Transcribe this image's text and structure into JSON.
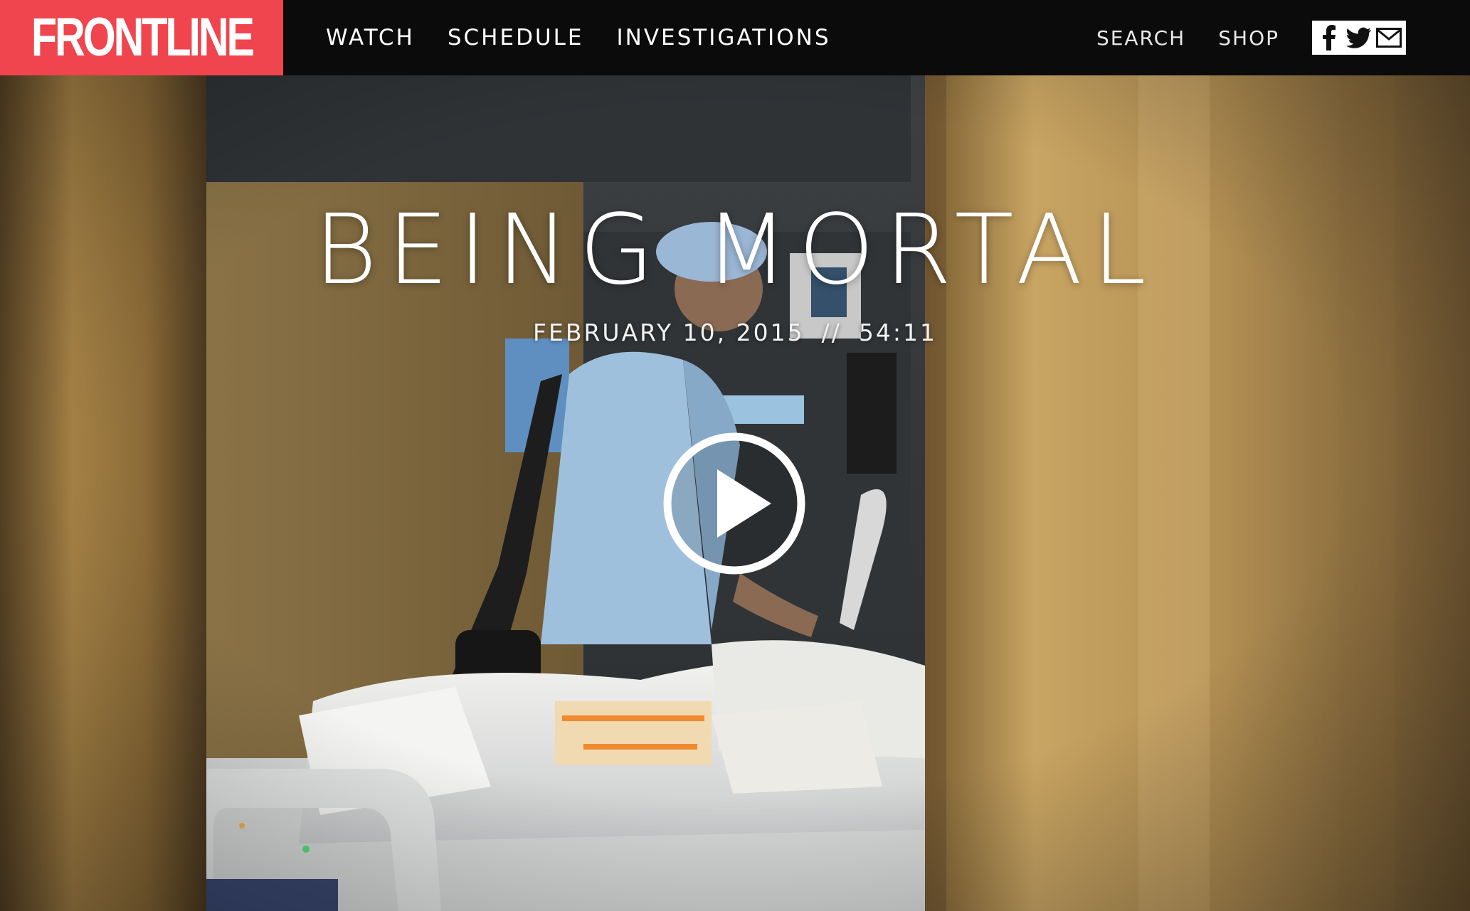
{
  "brand": {
    "logo_text": "FRONTLINE",
    "logo_color": "#f0444e"
  },
  "nav": {
    "primary": [
      {
        "label": "WATCH"
      },
      {
        "label": "SCHEDULE"
      },
      {
        "label": "INVESTIGATIONS"
      }
    ],
    "search_label": "SEARCH",
    "shop_label": "SHOP",
    "social": [
      {
        "icon": "facebook-icon"
      },
      {
        "icon": "twitter-icon"
      },
      {
        "icon": "email-icon"
      }
    ]
  },
  "hero": {
    "title": "BEING MORTAL",
    "date": "FEBRUARY 10, 2015",
    "separator": "//",
    "duration": "54:11",
    "play_icon": "play-icon",
    "background": "hospital room scene photo"
  }
}
